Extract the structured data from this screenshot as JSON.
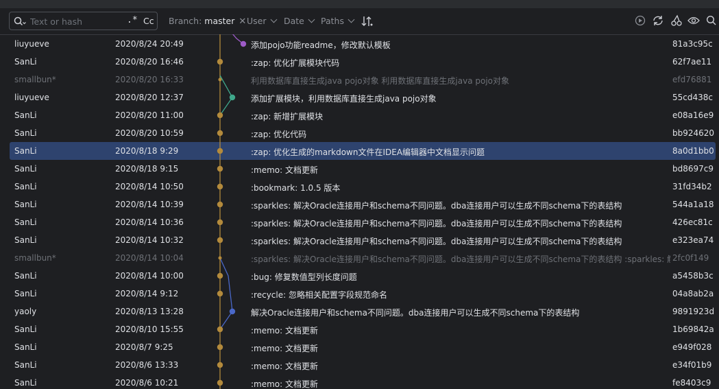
{
  "toolbar": {
    "search_placeholder": "Text or hash",
    "regex_label": ".*",
    "case_label": "Cc",
    "branch_prefix": "Branch:",
    "branch_value": "master",
    "user_label": "User",
    "date_label": "Date",
    "paths_label": "Paths"
  },
  "colors": {
    "background": "#1e1f22",
    "selection": "#2e436e",
    "branch_main": "#b38a3c",
    "branch_purple": "#9d5bc7",
    "branch_teal": "#3fa88b",
    "branch_blue": "#4a68c9"
  },
  "commits": [
    {
      "author": "liuyueve",
      "date": "2020/8/24 20:49",
      "message": "添加pojo功能readme，修改默认模板",
      "hash": "81a3c95c",
      "dim": false,
      "selected": false
    },
    {
      "author": "SanLi",
      "date": "2020/8/20 16:46",
      "message": ":zap: 优化扩展模块代码",
      "hash": "62f7ae11",
      "dim": false,
      "selected": false
    },
    {
      "author": "smallbun*",
      "date": "2020/8/20 16:33",
      "message": "利用数据库直接生成java pojo对象 利用数据库直接生成java pojo对象",
      "hash": "efd76881",
      "dim": true,
      "selected": false
    },
    {
      "author": "liuyueve",
      "date": "2020/8/20 12:37",
      "message": "添加扩展模块，利用数据库直接生成java pojo对象",
      "hash": "55cd438c",
      "dim": false,
      "selected": false
    },
    {
      "author": "SanLi",
      "date": "2020/8/20 11:00",
      "message": ":zap: 新增扩展模块",
      "hash": "e08a16e9",
      "dim": false,
      "selected": false
    },
    {
      "author": "SanLi",
      "date": "2020/8/20 10:59",
      "message": ":zap: 优化代码",
      "hash": "bb924620",
      "dim": false,
      "selected": false
    },
    {
      "author": "SanLi",
      "date": "2020/8/18 9:29",
      "message": ":zap: 优化生成的markdown文件在IDEA编辑器中文档显示问题",
      "hash": "8a0d1bb0",
      "dim": false,
      "selected": true
    },
    {
      "author": "SanLi",
      "date": "2020/8/18 9:15",
      "message": ":memo: 文档更新",
      "hash": "bd8697c9",
      "dim": false,
      "selected": false
    },
    {
      "author": "SanLi",
      "date": "2020/8/14 10:50",
      "message": ":bookmark: 1.0.5 版本",
      "hash": "31fd34b2",
      "dim": false,
      "selected": false
    },
    {
      "author": "SanLi",
      "date": "2020/8/14 10:39",
      "message": ":sparkles:  解决Oracle连接用户和schema不同问题。dba连接用户可以生成不同schema下的表结构",
      "hash": "544a1a18",
      "dim": false,
      "selected": false
    },
    {
      "author": "SanLi",
      "date": "2020/8/14 10:36",
      "message": ":sparkles:  解决Oracle连接用户和schema不同问题。dba连接用户可以生成不同schema下的表结构",
      "hash": "426ec81c",
      "dim": false,
      "selected": false
    },
    {
      "author": "SanLi",
      "date": "2020/8/14 10:32",
      "message": ":sparkles:  解决Oracle连接用户和schema不同问题。dba连接用户可以生成不同schema下的表结构",
      "hash": "e323ea74",
      "dim": false,
      "selected": false
    },
    {
      "author": "smallbun*",
      "date": "2020/8/14 10:04",
      "message": ":sparkles: 解决Oracle连接用户和schema不同问题。dba连接用户可以生成不同schema下的表结构 :sparkles: 解决",
      "hash": "2fc0f149",
      "dim": true,
      "selected": false
    },
    {
      "author": "SanLi",
      "date": "2020/8/14 10:00",
      "message": ":bug: 修复数值型列长度问题",
      "hash": "a5458b3c",
      "dim": false,
      "selected": false
    },
    {
      "author": "SanLi",
      "date": "2020/8/14 9:12",
      "message": ":recycle: 忽略相关配置字段规范命名",
      "hash": "04a8ab2a",
      "dim": false,
      "selected": false
    },
    {
      "author": "yaoly",
      "date": "2020/8/13 13:28",
      "message": "解决Oracle连接用户和schema不同问题。dba连接用户可以生成不同schema下的表结构",
      "hash": "9891923d",
      "dim": false,
      "selected": false
    },
    {
      "author": "SanLi",
      "date": "2020/8/10 15:55",
      "message": ":memo: 文档更新",
      "hash": "1b69842a",
      "dim": false,
      "selected": false
    },
    {
      "author": "SanLi",
      "date": "2020/8/7 9:25",
      "message": ":memo: 文档更新",
      "hash": "e949f028",
      "dim": false,
      "selected": false
    },
    {
      "author": "SanLi",
      "date": "2020/8/6 13:33",
      "message": ":memo: 文档更新",
      "hash": "e34f01b9",
      "dim": false,
      "selected": false
    },
    {
      "author": "SanLi",
      "date": "2020/8/6 10:21",
      "message": ":memo: 文档更新",
      "hash": "fe8403c9",
      "dim": false,
      "selected": false
    }
  ]
}
